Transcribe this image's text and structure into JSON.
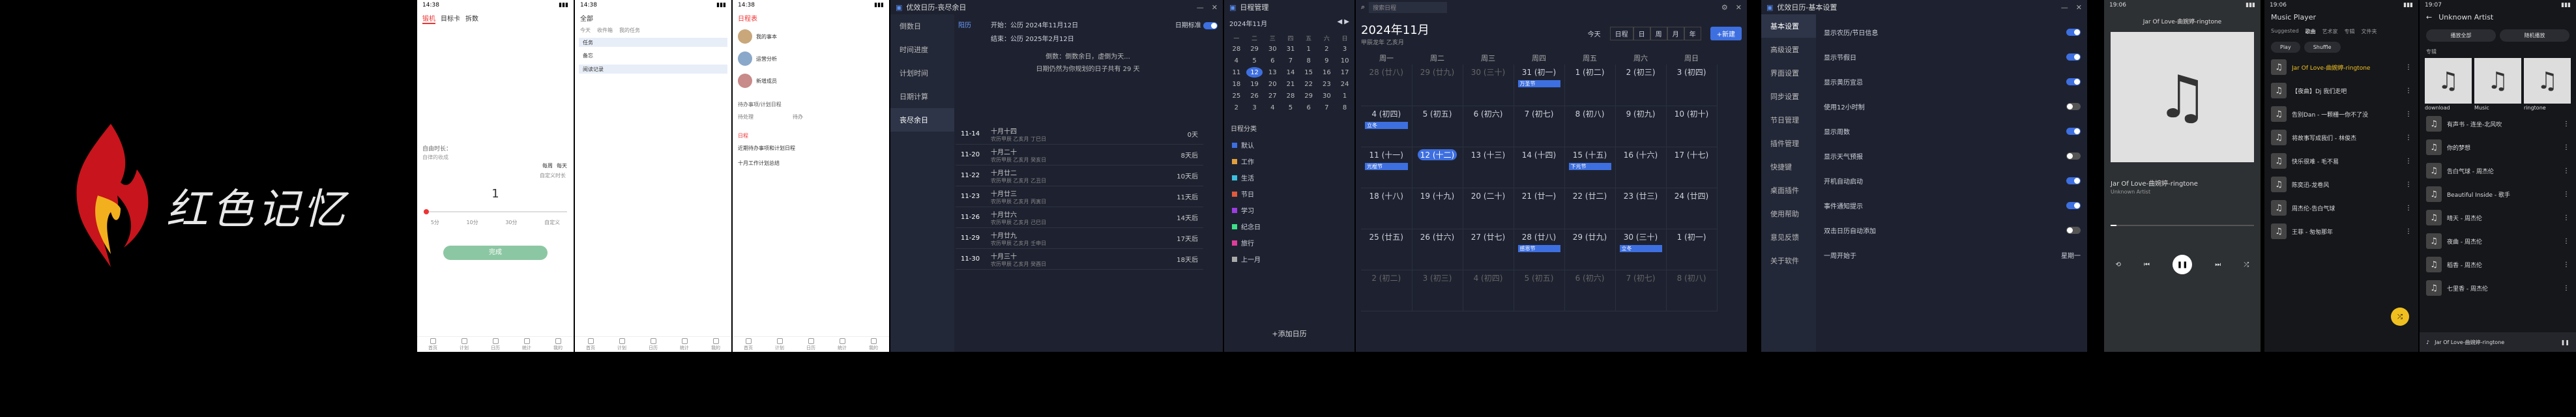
{
  "brand": {
    "text": "红色记忆"
  },
  "phone1": {
    "time": "14:38",
    "tabs": [
      "锻机",
      "目标卡",
      "拆数"
    ],
    "label": "自由时长：",
    "sub": "自律的收成",
    "blocks": [
      "每周",
      "每天"
    ],
    "small": "自定义时长",
    "big": "1",
    "units": [
      "5分",
      "10分",
      "30分",
      "自定义"
    ],
    "button": "完成",
    "nav": [
      "首页",
      "计划",
      "日历",
      "统计",
      "我的"
    ]
  },
  "phone2": {
    "time": "14:38",
    "title": "全部",
    "tabs": [
      "今天",
      "收件箱",
      "我的任务"
    ],
    "items": [
      "任务",
      "备忘",
      "阅读记录"
    ],
    "nav": [
      "首页",
      "计划",
      "日历",
      "统计",
      "我的"
    ]
  },
  "phone3": {
    "time": "14:38",
    "title": "日程表",
    "items": [
      "我的事本",
      "运营分析",
      "新增成员"
    ],
    "sections": [
      "待办事项/计划日程",
      "待处理",
      "待办",
      "日程"
    ],
    "feed": [
      "近期待办事项和计划日程",
      "十月工作计划总结"
    ],
    "nav": [
      "首页",
      "计划",
      "日历",
      "统计",
      "我的"
    ]
  },
  "winA": {
    "title": "优效日历-丧尽余日",
    "side": [
      "倒数日",
      "时间进度",
      "计划时间",
      "日期计算",
      "丧尽余日"
    ],
    "header": {
      "label": "阳历",
      "start": "开始：公历 2024年11月12日",
      "end": "结束：公历 2025年2月12日",
      "toggle": "日期标准",
      "line1": "倒数：倒数余日，虚倒为天...",
      "line2": "日期仍然为你规划的日子共有 29 天"
    },
    "rows": [
      [
        "11-14",
        "十月十四",
        "农历甲辰 乙亥月 丁巳日",
        "0天"
      ],
      [
        "11-20",
        "十月二十",
        "农历甲辰 乙亥月 癸亥日",
        "8天后"
      ],
      [
        "11-22",
        "十月廿二",
        "农历甲辰 乙亥月 乙丑日",
        "10天后"
      ],
      [
        "11-23",
        "十月廿三",
        "农历甲辰 乙亥月 丙寅日",
        "11天后"
      ],
      [
        "11-26",
        "十月廿六",
        "农历甲辰 乙亥月 己巳日",
        "14天后"
      ],
      [
        "11-29",
        "十月廿九",
        "农历甲辰 乙亥月 壬申日",
        "17天后"
      ],
      [
        "11-30",
        "十月三十",
        "农历甲辰 乙亥月 癸酉日",
        "18天后"
      ]
    ]
  },
  "winB": {
    "title": "日程管理",
    "month": "2024年11月",
    "week": [
      "一",
      "二",
      "三",
      "四",
      "五",
      "六",
      "日"
    ],
    "days": [
      [
        "28",
        "29",
        "30",
        "31",
        "1",
        "2",
        "3"
      ],
      [
        "4",
        "5",
        "6",
        "7",
        "8",
        "9",
        "10"
      ],
      [
        "11",
        "12",
        "13",
        "14",
        "15",
        "16",
        "17"
      ],
      [
        "18",
        "19",
        "20",
        "21",
        "22",
        "23",
        "24"
      ],
      [
        "25",
        "26",
        "27",
        "28",
        "29",
        "30",
        "1"
      ],
      [
        "2",
        "3",
        "4",
        "5",
        "6",
        "7",
        "8"
      ]
    ],
    "list_title": "日程分类",
    "cats": [
      "默认",
      "工作",
      "生活",
      "节日",
      "学习",
      "纪念日",
      "旅行",
      "上一月"
    ],
    "add": "+添加日历"
  },
  "winC": {
    "search": "搜索日程",
    "title": "2024年11月",
    "sub": "甲辰龙年 乙亥月",
    "today": "今天",
    "views": [
      "日程",
      "日",
      "周",
      "月",
      "年"
    ],
    "add": "+新建",
    "week": [
      "周一",
      "周二",
      "周三",
      "周四",
      "周五",
      "周六",
      "周日"
    ],
    "cells": [
      [
        "28 (廿八)",
        "29 (廿九)",
        "30 (三十)",
        "31 (初一)",
        "1 (初二)",
        "2 (初三)",
        "3 (初四)"
      ],
      [
        "4 (初四)",
        "5 (初五)",
        "6 (初六)",
        "7 (初七)",
        "8 (初八)",
        "9 (初九)",
        "10 (初十)"
      ],
      [
        "11 (十一)",
        "12 (十二)",
        "13 (十三)",
        "14 (十四)",
        "15 (十五)",
        "16 (十六)",
        "17 (十七)"
      ],
      [
        "18 (十八)",
        "19 (十九)",
        "20 (二十)",
        "21 (廿一)",
        "22 (廿二)",
        "23 (廿三)",
        "24 (廿四)"
      ],
      [
        "25 (廿五)",
        "26 (廿六)",
        "27 (廿七)",
        "28 (廿八)",
        "29 (廿九)",
        "30 (三十)",
        "1 (初一)"
      ],
      [
        "2 (初二)",
        "3 (初三)",
        "4 (初四)",
        "5 (初五)",
        "6 (初六)",
        "7 (初七)",
        "8 (初八)"
      ]
    ],
    "events": [
      [
        "万圣节",
        "0",
        "3"
      ],
      [
        "立冬",
        "1",
        "0"
      ],
      [
        "光棍节",
        "2",
        "0"
      ],
      [
        "下元节",
        "2",
        "4"
      ],
      [
        "感恩节",
        "4",
        "3"
      ],
      [
        "立冬",
        "4",
        "5"
      ]
    ]
  },
  "winD": {
    "title": "优效日历-基本设置",
    "side": [
      "基本设置",
      "高级设置",
      "界面设置",
      "同步设置",
      "节日管理",
      "插件管理",
      "快捷键",
      "桌面插件",
      "使用帮助",
      "意见反馈",
      "关于软件"
    ],
    "rows": [
      [
        "显示农历/节日信息",
        "on"
      ],
      [
        "显示节假日",
        "on"
      ],
      [
        "显示黄历宜忌",
        "on"
      ],
      [
        "使用12小时制",
        "off"
      ],
      [
        "显示周数",
        "on"
      ],
      [
        "显示天气预报",
        "off"
      ],
      [
        "开机自动启动",
        "on"
      ],
      [
        "事件通知提示",
        "on"
      ],
      [
        "双击日历自动添加",
        "off"
      ],
      [
        "一周开始于",
        "星期一"
      ]
    ]
  },
  "phone4": {
    "time": "19:06",
    "song": "Jar Of Love-曲婉婷-ringtone",
    "artist": "Unknown Artist"
  },
  "phone5": {
    "time": "19:06",
    "title": "Music Player",
    "tabs": [
      "Suggested",
      "歌曲",
      "艺术家",
      "专辑",
      "文件夹"
    ],
    "play": "Play",
    "shuffle": "Shuffle",
    "songs": [
      "Jar Of Love-曲婉婷-ringtone",
      "【夜曲】Dj 我们走吧",
      "告别Dan - 一颗栅一你不了没",
      "将故事写成我们 - 林俊杰",
      "快乐很难 - 毛不易",
      "陈奕迅-龙卷风",
      "周杰伦-告白气球",
      "王菲 - 匆匆那年"
    ]
  },
  "phone6": {
    "time": "19:07",
    "title": "Unknown Artist",
    "play": "播放全部",
    "shuffle": "随机播放",
    "section": "专辑",
    "albums": [
      "download",
      "Music",
      "ringtone"
    ],
    "songs": [
      "有声书 - 连坐-北风吹",
      "你的梦想",
      "告白气球 - 周杰伦",
      "Beautiful Inside - 歌手",
      "晴天 - 周杰伦",
      "夜曲 - 周杰伦",
      "稻香 - 周杰伦",
      "七里香 - 周杰伦"
    ],
    "now": "Jar Of Love-曲婉婷-ringtone"
  }
}
